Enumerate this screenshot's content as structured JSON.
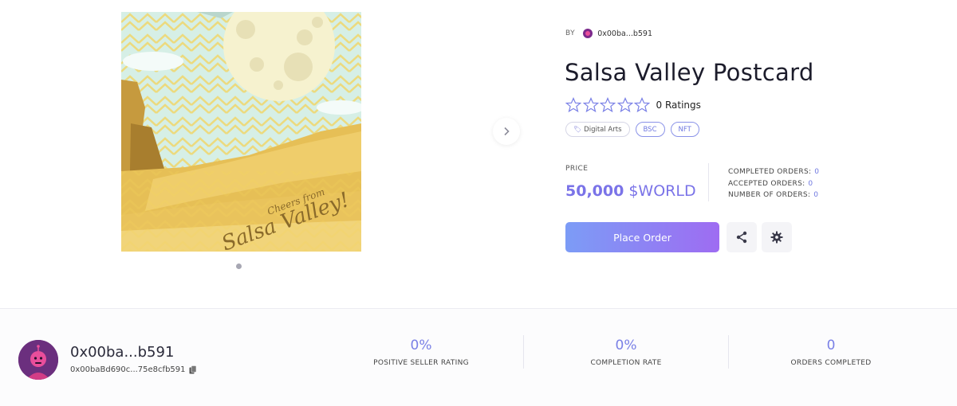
{
  "gallery": {
    "image_caption_line1": "Cheers from",
    "image_caption_line2": "Salsa Valley!"
  },
  "item": {
    "by_label": "BY",
    "creator_short": "0x00ba...b591",
    "title": "Salsa Valley Postcard",
    "ratings_text": "0 Ratings",
    "stars_filled": 0,
    "stars_total": 5,
    "tags": [
      {
        "label": "Digital Arts",
        "icon": "tag-icon"
      },
      {
        "label": "BSC"
      },
      {
        "label": "NFT"
      }
    ],
    "price_label": "PRICE",
    "price_value": "50,000",
    "price_currency": "$WORLD",
    "orders": {
      "completed_label": "COMPLETED ORDERS:",
      "completed_value": "0",
      "accepted_label": "ACCEPTED ORDERS:",
      "accepted_value": "0",
      "number_label": "NUMBER OF ORDERS:",
      "number_value": "0"
    },
    "place_order_label": "Place Order"
  },
  "seller": {
    "name": "0x00ba...b591",
    "address": "0x00baBd690c...75e8cfb591",
    "stats": [
      {
        "value": "0%",
        "label": "POSITIVE SELLER RATING"
      },
      {
        "value": "0%",
        "label": "COMPLETION RATE"
      },
      {
        "value": "0",
        "label": "ORDERS COMPLETED"
      }
    ]
  },
  "colors": {
    "accent": "#7a73e8",
    "button_gradient_start": "#7c9cf6",
    "button_gradient_end": "#9e6cf2"
  }
}
